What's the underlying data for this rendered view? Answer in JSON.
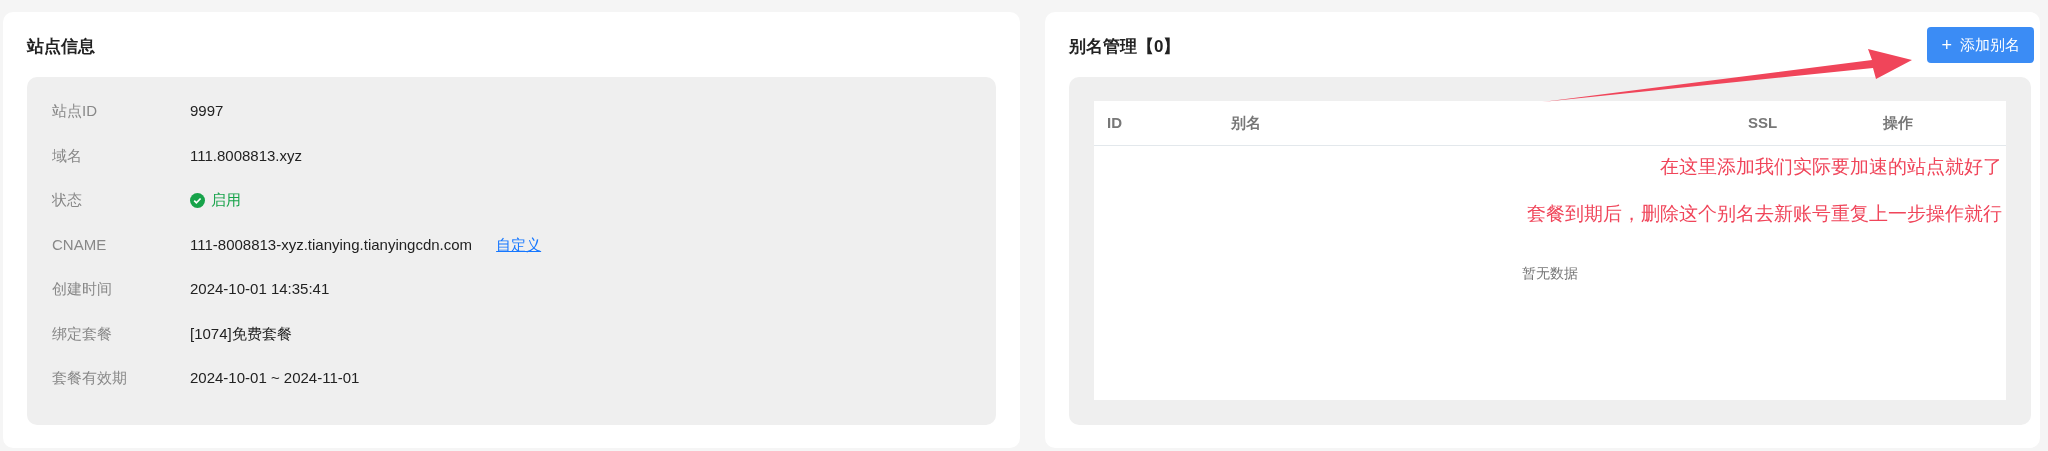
{
  "site_info": {
    "title": "站点信息",
    "rows": [
      {
        "label": "站点ID",
        "kind": "text",
        "value": "9997"
      },
      {
        "label": "域名",
        "kind": "text",
        "value": "111.8008813.xyz"
      },
      {
        "label": "状态",
        "kind": "status",
        "value": "启用",
        "on": true
      },
      {
        "label": "CNAME",
        "kind": "link",
        "value": "111-8008813-xyz.tianying.tianyingcdn.com",
        "link": "自定义"
      },
      {
        "label": "创建时间",
        "kind": "text",
        "value": "2024-10-01 14:35:41"
      },
      {
        "label": "绑定套餐",
        "kind": "text",
        "value": "[1074]免费套餐"
      },
      {
        "label": "套餐有效期",
        "kind": "text",
        "value": "2024-10-01 ~ 2024-11-01"
      }
    ]
  },
  "alias": {
    "title": "别名管理【0】",
    "add_button": {
      "icon": "+",
      "label": "添加别名"
    },
    "table": {
      "columns": [
        "ID",
        "别名",
        "SSL",
        "操作"
      ],
      "empty_text": "暂无数据"
    },
    "annotations": [
      "在这里添加我们实际要加速的站点就好了",
      "套餐到期后，删除这个别名去新账号重复上一步操作就行"
    ]
  }
}
